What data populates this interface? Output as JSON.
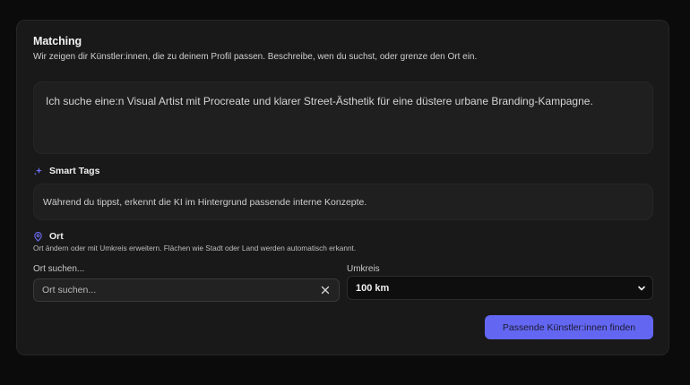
{
  "matching": {
    "title": "Matching",
    "subtitle": "Wir zeigen dir Künstler:innen, die zu deinem Profil passen. Beschreibe, wen du suchst, oder grenze den Ort ein.",
    "query": "Ich suche eine:n Visual Artist mit Procreate und klarer Street-Ästhetik für eine düstere urbane Branding-Kampagne."
  },
  "smart_tags": {
    "title": "Smart Tags",
    "hint": "Während du tippst, erkennt die KI im Hintergrund passende interne Konzepte.",
    "icon": "sparkles-icon",
    "accent": "#6366f1"
  },
  "ort": {
    "title": "Ort",
    "icon": "map-pin-icon",
    "hint": "Ort ändern oder mit Umkreis erweitern. Flächen wie Stadt oder Land werden automatisch erkannt.",
    "search_label": "Ort suchen...",
    "search_placeholder": "Ort suchen...",
    "search_value": "",
    "radius_label": "Umkreis",
    "radius_value": "100 km"
  },
  "actions": {
    "submit_label": "Passende Künstler:innen finden",
    "submit_color": "#6366f1"
  }
}
